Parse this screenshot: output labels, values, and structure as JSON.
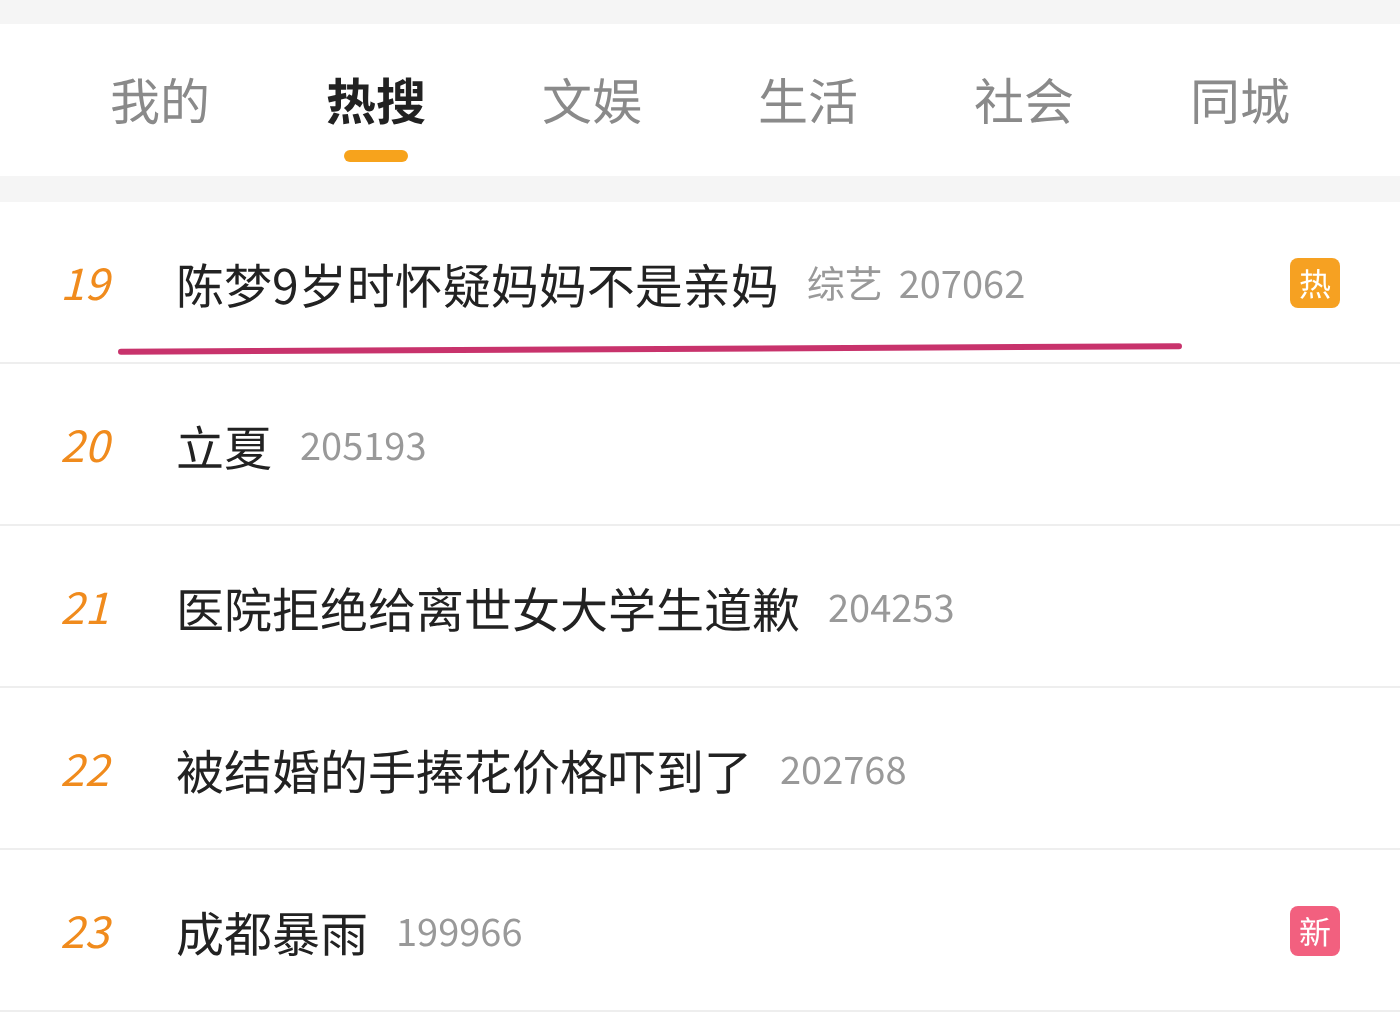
{
  "tabs": [
    {
      "label": "我的",
      "selected": false
    },
    {
      "label": "热搜",
      "selected": true
    },
    {
      "label": "文娱",
      "selected": false
    },
    {
      "label": "生活",
      "selected": false
    },
    {
      "label": "社会",
      "selected": false
    },
    {
      "label": "同城",
      "selected": false
    }
  ],
  "rows": [
    {
      "rank": "19",
      "title": "陈梦9岁时怀疑妈妈不是亲妈",
      "category": "综艺",
      "count": "207062",
      "badge": {
        "kind": "hot",
        "text": "热"
      },
      "underlined": true
    },
    {
      "rank": "20",
      "title": "立夏",
      "count": "205193"
    },
    {
      "rank": "21",
      "title": "医院拒绝给离世女大学生道歉",
      "count": "204253"
    },
    {
      "rank": "22",
      "title": "被结婚的手捧花价格吓到了",
      "count": "202768"
    },
    {
      "rank": "23",
      "title": "成都暴雨",
      "count": "199966",
      "badge": {
        "kind": "new",
        "text": "新"
      }
    }
  ]
}
